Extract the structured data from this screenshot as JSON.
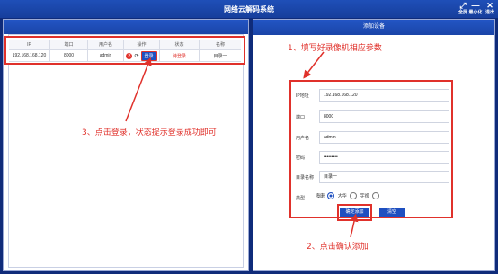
{
  "app": {
    "title": "网络云解码系统",
    "controls": [
      {
        "glyph": "⤢",
        "label": "全屏"
      },
      {
        "glyph": "—",
        "label": "最小化"
      },
      {
        "glyph": "✕",
        "label": "退出"
      }
    ]
  },
  "device_table": {
    "headers": [
      "IP",
      "端口",
      "用户名",
      "操作",
      "状态",
      "名称"
    ],
    "row": {
      "ip": "192.168.168.120",
      "port": "8000",
      "username": "admin",
      "delete_glyph": "✕",
      "refresh_glyph": "⟳",
      "login_label": "登录",
      "status": "待登录",
      "name": "目录一"
    }
  },
  "add_device": {
    "panel_title": "添加设备",
    "fields": {
      "ip": {
        "label": "IP地址",
        "value": "192.168.168.120"
      },
      "port": {
        "label": "端口",
        "value": "8000"
      },
      "username": {
        "label": "用户名",
        "value": "admin"
      },
      "password": {
        "label": "密码",
        "value": "•••••••••"
      },
      "catalog": {
        "label": "目录名称",
        "value": "目录一"
      }
    },
    "type": {
      "label": "类型",
      "options": [
        "海康",
        "大华",
        "宇视"
      ],
      "selected": "海康"
    },
    "confirm_label": "确定添加",
    "clear_label": "清空"
  },
  "annotations": {
    "step1": "1、填写好录像机相应参数",
    "step2": "2、点击确认添加",
    "step3": "3、点击登录，状态提示登录成功即可"
  },
  "colors": {
    "highlight": "#e0312b",
    "primary": "#1e4fc0",
    "background": "#0f2b7a"
  }
}
